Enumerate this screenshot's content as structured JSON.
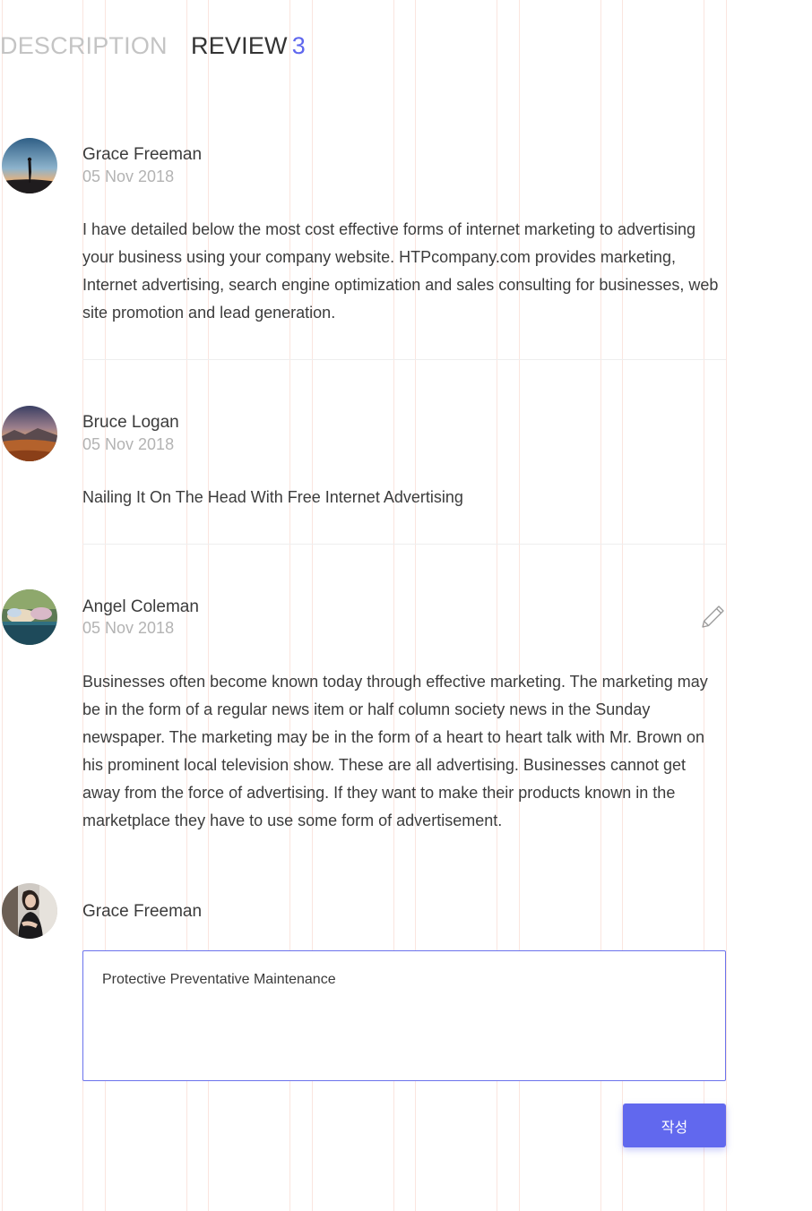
{
  "tabs": {
    "description_label": "DESCRIPTION",
    "review_label": "REVIEW",
    "review_count": "3"
  },
  "reviews": [
    {
      "name": "Grace Freeman",
      "date": "05 Nov 2018",
      "text": "I have detailed below the most cost effective forms of internet marketing to advertising your business using your company website. HTPcompany.com provides marketing, Internet advertising, search engine optimization and sales consulting for businesses, web site promotion and lead generation."
    },
    {
      "name": "Bruce Logan",
      "date": "05 Nov 2018",
      "text": "Nailing It On The Head With Free Internet Advertising"
    },
    {
      "name": "Angel Coleman",
      "date": "05 Nov 2018",
      "text": "Businesses often become known today through effective marketing. The marketing may be in the form of a regular news item or half column society news in the Sunday newspaper. The marketing may be in the form of a heart to heart talk with Mr. Brown on his prominent local television show. These are all advertising. Businesses cannot get away from the force of advertising. If they want to make their products known in the marketplace they have to use some form of advertisement.",
      "edit_icon": "pencil-icon"
    }
  ],
  "compose": {
    "name": "Grace Freeman",
    "input_value": "Protective Preventative Maintenance",
    "submit_label": "작성"
  },
  "colors": {
    "accent": "#6168ee",
    "input_border": "#6b73ec",
    "muted_text": "#b3b3b3"
  }
}
